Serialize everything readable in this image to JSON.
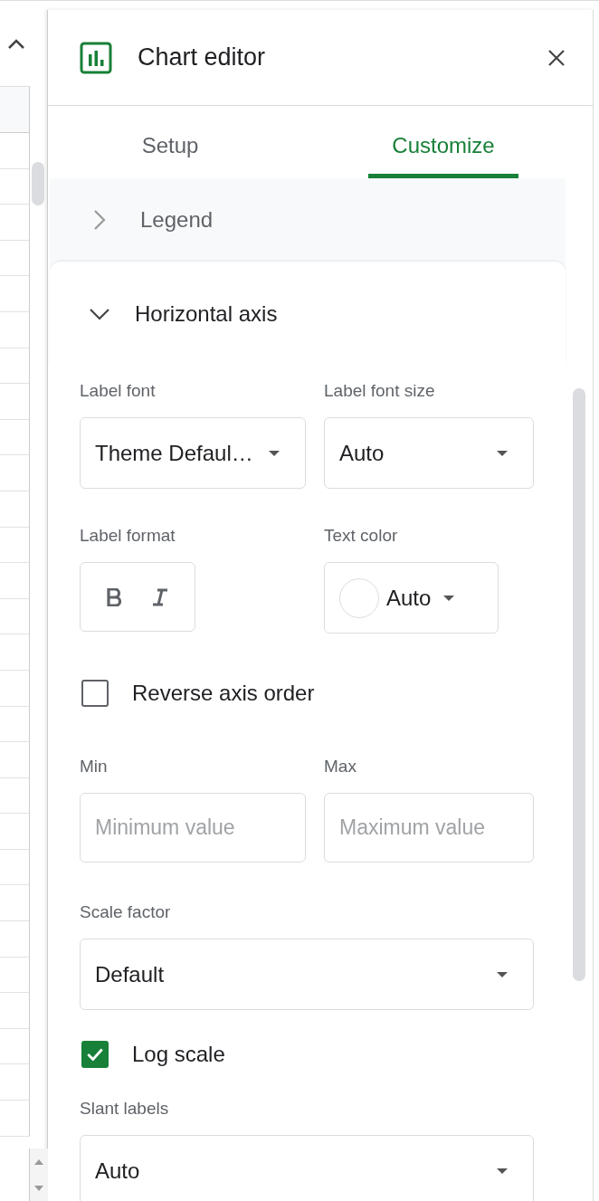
{
  "header": {
    "title": "Chart editor"
  },
  "tabs": [
    {
      "label": "Setup",
      "selected": false
    },
    {
      "label": "Customize",
      "selected": true
    }
  ],
  "sections": [
    {
      "title": "Legend",
      "expanded": false
    },
    {
      "title": "Horizontal axis",
      "expanded": true
    }
  ],
  "horizontal_axis": {
    "label_font": {
      "label": "Label font",
      "value": "Theme Defaul…"
    },
    "label_font_size": {
      "label": "Label font size",
      "value": "Auto"
    },
    "label_format": {
      "label": "Label format"
    },
    "text_color": {
      "label": "Text color",
      "value": "Auto"
    },
    "reverse_axis_order": {
      "label": "Reverse axis order",
      "checked": false
    },
    "min": {
      "label": "Min",
      "placeholder": "Minimum value"
    },
    "max": {
      "label": "Max",
      "placeholder": "Maximum value"
    },
    "scale_factor": {
      "label": "Scale factor",
      "value": "Default"
    },
    "log_scale": {
      "label": "Log scale",
      "checked": true
    },
    "slant_labels": {
      "label": "Slant labels",
      "value": "Auto"
    }
  }
}
